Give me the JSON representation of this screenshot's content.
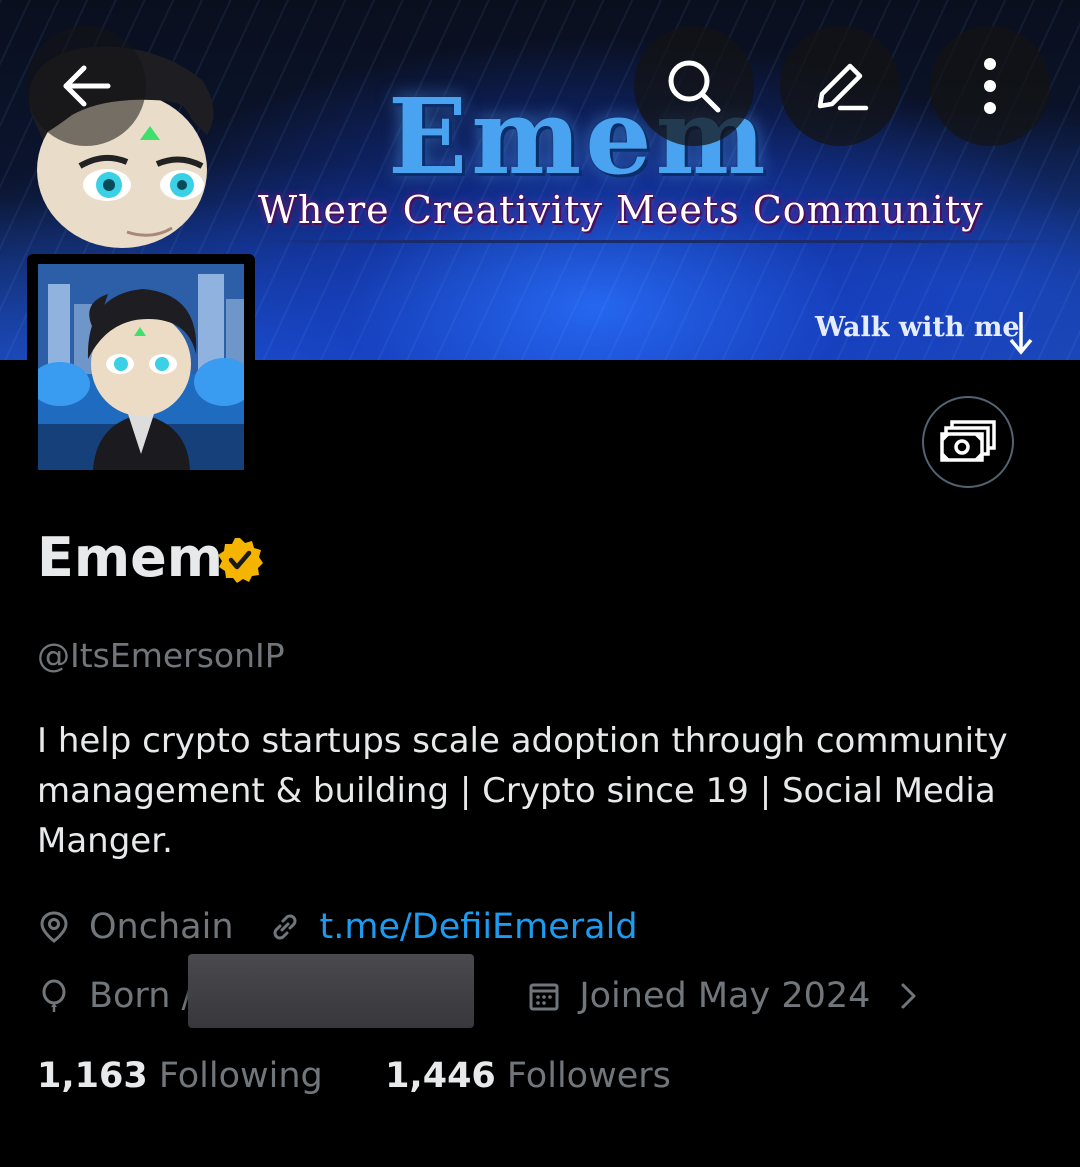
{
  "banner": {
    "title": "Emem",
    "tagline": "Where Creativity Meets Community",
    "cta": "Walk with me"
  },
  "top_bar": {
    "back_icon": "arrow-left-icon",
    "search_icon": "search-icon",
    "edit_icon": "pencil-icon",
    "more_icon": "more-vertical-icon"
  },
  "profile": {
    "name": "Emem",
    "verified_color": "#f4b400",
    "handle": "@ItsEmersonIP",
    "bio": "I help crypto startups scale adoption through community management & building | Crypto since 19 | Social Media Manger.",
    "location": "Onchain",
    "link": "t.me/DefiiEmerald",
    "born_prefix": "Born /",
    "joined": "Joined May 2024",
    "tip_icon": "money-icon"
  },
  "stats": {
    "following_count": "1,163",
    "following_label": "Following",
    "followers_count": "1,446",
    "followers_label": "Followers"
  },
  "colors": {
    "background": "#000000",
    "text_primary": "#e7e9ea",
    "text_secondary": "#71767b",
    "link": "#1d9bf0"
  }
}
